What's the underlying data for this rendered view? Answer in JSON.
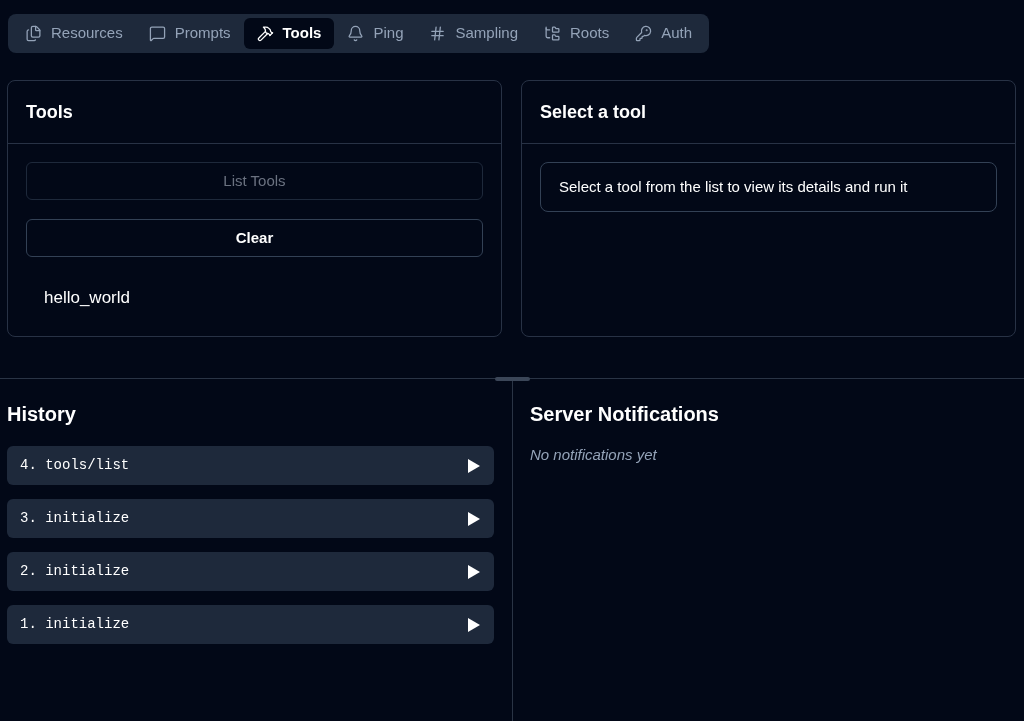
{
  "tabs": [
    {
      "label": "Resources",
      "selected": false
    },
    {
      "label": "Prompts",
      "selected": false
    },
    {
      "label": "Tools",
      "selected": true
    },
    {
      "label": "Ping",
      "selected": false
    },
    {
      "label": "Sampling",
      "selected": false
    },
    {
      "label": "Roots",
      "selected": false
    },
    {
      "label": "Auth",
      "selected": false
    }
  ],
  "tools_panel": {
    "title": "Tools",
    "buttons": [
      {
        "label": "List Tools",
        "disabled": true
      },
      {
        "label": "Clear",
        "disabled": false
      }
    ],
    "items": [
      "hello_world"
    ]
  },
  "details_panel": {
    "title": "Select a tool",
    "message": "Select a tool from the list to view its details and run it"
  },
  "history": {
    "title": "History",
    "items": [
      {
        "label": "4. tools/list",
        "expanded": false
      },
      {
        "label": "3. initialize",
        "expanded": false
      },
      {
        "label": "2. initialize",
        "expanded": false
      },
      {
        "label": "1. initialize",
        "expanded": false
      }
    ]
  },
  "notifications": {
    "title": "Server Notifications",
    "empty_message": "No notifications yet"
  }
}
